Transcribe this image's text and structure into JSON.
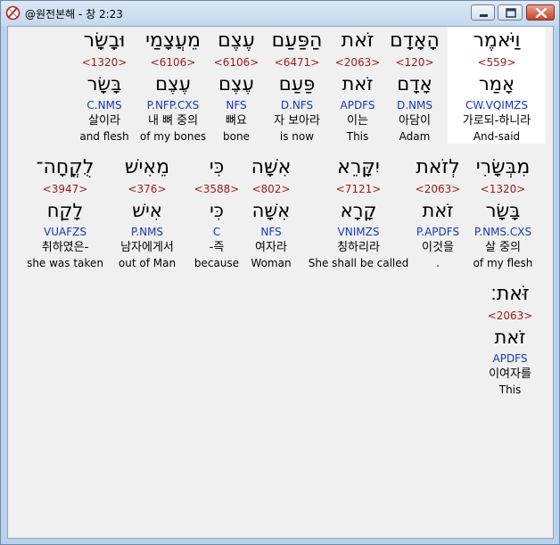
{
  "window": {
    "title": "@원전본해 - 창 2:23",
    "app_icon": "compass-icon"
  },
  "colors": {
    "strong": "#9a1b1b",
    "parse": "#1a35b5",
    "highlight": "#ffffff",
    "background": "#f0f0f0"
  },
  "words": [
    {
      "heb": "וַיֹּאמֶר",
      "strong": "<559>",
      "lemma": "אָמַר",
      "parse": "CW.VQIMZS",
      "ko": "가로되-하니라",
      "en": "And-said"
    },
    {
      "heb": "הָאָדָם",
      "strong": "<120>",
      "lemma": "אָדָם",
      "parse": "D.NMS",
      "ko": "아담이",
      "en": "Adam"
    },
    {
      "heb": "זֹאת",
      "strong": "<2063>",
      "lemma": "זֹאת",
      "parse": "APDFS",
      "ko": "이는",
      "en": "This"
    },
    {
      "heb": "הַפַּעַם",
      "strong": "<6471>",
      "lemma": "פַּעַם",
      "parse": "D.NFS",
      "ko": "자 보아라",
      "en": "is now"
    },
    {
      "heb": "עֶצֶם",
      "strong": "<6106>",
      "lemma": "עֶצֶם",
      "parse": "NFS",
      "ko": "뼈요",
      "en": "bone"
    },
    {
      "heb": "מֵעֲצָמַי",
      "strong": "<6106>",
      "lemma": "עֶצֶם",
      "parse": "P.NFP.CXS",
      "ko": "내 뼈 중의",
      "en": "of my bones"
    },
    {
      "heb": "וּבָשָׂר",
      "strong": "<1320>",
      "lemma": "בָּשָׂר",
      "parse": "C.NMS",
      "ko": "살이라",
      "en": "and flesh"
    },
    {
      "heb": "מִבְּשָׂרִי",
      "strong": "<1320>",
      "lemma": "בָּשָׂר",
      "parse": "P.NMS.CXS",
      "ko": "살 중의",
      "en": "of my flesh"
    },
    {
      "heb": "לְזֹאת",
      "strong": "<2063>",
      "lemma": "זֹאת",
      "parse": "P.APDFS",
      "ko": "이것을",
      "en": "."
    },
    {
      "heb": "יִקָּרֵא",
      "strong": "<7121>",
      "lemma": "קָרָא",
      "parse": "VNIMZS",
      "ko": "칭하리라",
      "en": "She shall be called"
    },
    {
      "heb": "אִשָּׁה",
      "strong": "<802>",
      "lemma": "אִשָּׁה",
      "parse": "NFS",
      "ko": "여자라",
      "en": "Woman"
    },
    {
      "heb": "כִּי",
      "strong": "<3588>",
      "lemma": "כִּי",
      "parse": "C",
      "ko": "-즉",
      "en": "because"
    },
    {
      "heb": "מֵאִישׁ",
      "strong": "<376>",
      "lemma": "אִישׁ",
      "parse": "P.NMS",
      "ko": "남자에게서",
      "en": "out of Man"
    },
    {
      "heb": "לֻקֳחָה־",
      "strong": "<3947>",
      "lemma": "לָקַח",
      "parse": "VUAFZS",
      "ko": "취하였은-",
      "en": "she was taken"
    },
    {
      "heb": "זֹּאת׃",
      "strong": "<2063>",
      "lemma": "זֹאת",
      "parse": "APDFS",
      "ko": "이여자를",
      "en": "This"
    }
  ]
}
